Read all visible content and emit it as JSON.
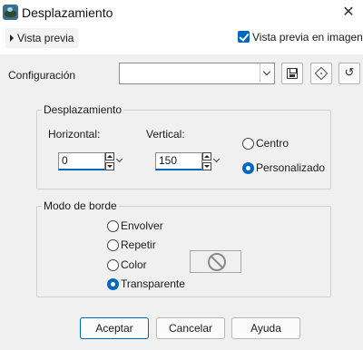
{
  "window": {
    "title": "Desplazamiento"
  },
  "preview": {
    "toggle_label": "Vista previa",
    "checkbox_label": "Vista previa en imagen",
    "checked": true
  },
  "config": {
    "label": "Configuración",
    "value": ""
  },
  "displacement": {
    "legend": "Desplazamiento",
    "horizontal": {
      "label": "Horizontal:",
      "value": "0"
    },
    "vertical": {
      "label": "Vertical:",
      "value": "150"
    },
    "options": [
      "Centro",
      "Personalizado"
    ],
    "selected": "Personalizado"
  },
  "edge_mode": {
    "legend": "Modo de borde",
    "options": [
      "Envolver",
      "Repetir",
      "Color",
      "Transparente"
    ],
    "selected": "Transparente"
  },
  "buttons": {
    "ok": "Aceptar",
    "cancel": "Cancelar",
    "help": "Ayuda"
  },
  "colors": {
    "accent": "#0067c0",
    "panel": "#f0f0f0"
  }
}
